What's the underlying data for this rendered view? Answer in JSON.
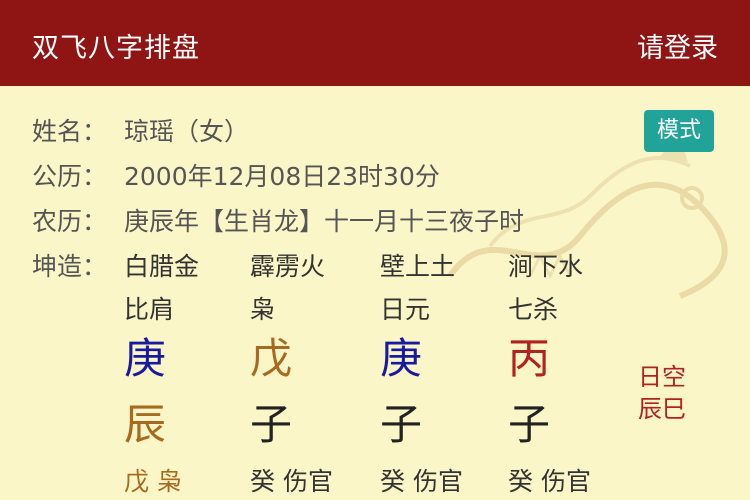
{
  "header": {
    "title": "双飞八字排盘",
    "login": "请登录"
  },
  "info": {
    "name_label": "姓名：",
    "name_value": "琼瑶（女）",
    "solar_label": "公历：",
    "solar_value": "2000年12月08日23时30分",
    "lunar_label": "农历：",
    "lunar_value": "庚辰年【生肖龙】十一月十三夜子时",
    "kun_label": "坤造："
  },
  "mode_button": "模式",
  "pillars": [
    {
      "nayin": "白腊金",
      "ten_god": "比肩",
      "stem": "庚",
      "stem_color": "#1a1aa0",
      "branch": "辰",
      "branch_color": "#a86a1e",
      "hidden": "戊 枭",
      "hidden_color": "#a86a1e"
    },
    {
      "nayin": "霹雳火",
      "ten_god": "枭",
      "stem": "戊",
      "stem_color": "#a86a1e",
      "branch": "子",
      "branch_color": "#222222",
      "hidden": "癸 伤官",
      "hidden_color": "#333333"
    },
    {
      "nayin": "壁上土",
      "ten_god": "日元",
      "stem": "庚",
      "stem_color": "#1a1aa0",
      "branch": "子",
      "branch_color": "#222222",
      "hidden": "癸 伤官",
      "hidden_color": "#333333"
    },
    {
      "nayin": "涧下水",
      "ten_god": "七杀",
      "stem": "丙",
      "stem_color": "#b22222",
      "branch": "子",
      "branch_color": "#222222",
      "hidden": "癸 伤官",
      "hidden_color": "#333333"
    }
  ],
  "day_empty": {
    "line1": "日空",
    "line2": "辰巳"
  },
  "colors": {
    "header_bg": "#8f1414",
    "page_bg": "#fbf6c8",
    "button_bg": "#22a39a"
  }
}
